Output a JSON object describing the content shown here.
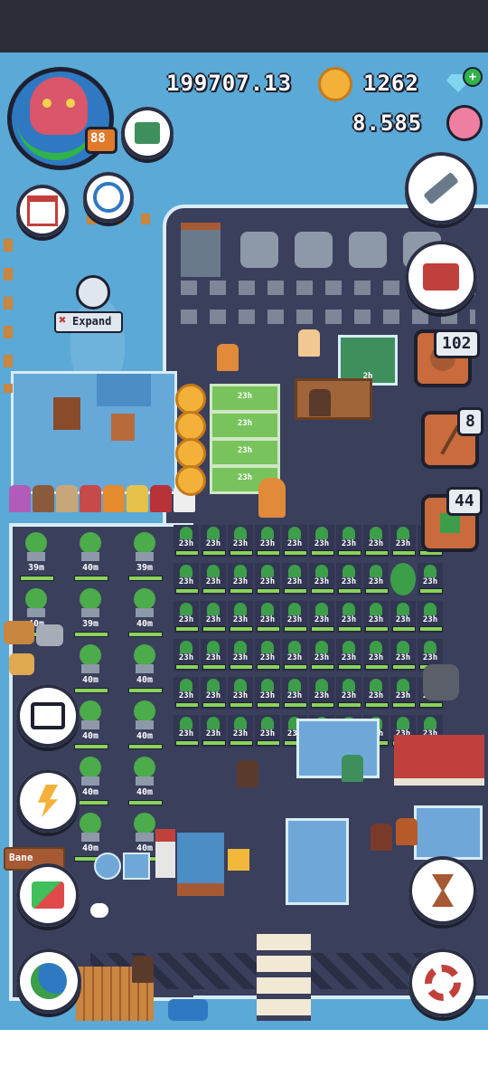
{
  "hud": {
    "gold": "199707.13",
    "gems": "1262",
    "flowers": "8.585",
    "level": "88"
  },
  "left_panel": {
    "expand_label": "Expand"
  },
  "badges": {
    "b102": "102",
    "b8": "8",
    "b44": "44"
  },
  "field_timers": {
    "crop_timer": "23h",
    "building_timer": "2h"
  },
  "trees": {
    "t39": "39m",
    "t40": "40m"
  },
  "sign": {
    "banner": "Bane"
  },
  "colors": {
    "sea": "#5aa9d6",
    "island": "#3a3f5c",
    "crop_bar": "#8ad35a",
    "accent_orange": "#c96b3c"
  },
  "icons": {
    "avatar": "octopus-avatar-icon",
    "gold": "gold-coins-icon",
    "gems": "diamond-plus-icon",
    "flowers": "pink-flower-icon",
    "calendar": "calendar-icon",
    "book": "magnifier-book-icon",
    "clock": "book-clock-icon",
    "hammer": "hammer-icon",
    "toolbox": "toolbox-icon",
    "chat": "chat-icon",
    "energy": "lightning-icon",
    "swap": "swap-arrows-icon",
    "world": "globe-icon",
    "hourglass": "hourglass-icon",
    "settings": "gear-icon",
    "fishing": "fishing-rod-icon"
  }
}
